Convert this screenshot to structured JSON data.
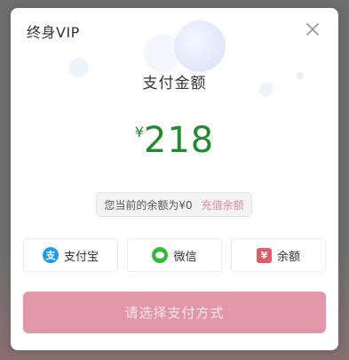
{
  "dialog": {
    "title": "终身VIP",
    "close_icon": "close-icon"
  },
  "payment": {
    "amount_label": "支付金额",
    "currency_symbol": "¥",
    "amount": "218",
    "balance_text": "您当前的余额为¥0",
    "recharge_link": "充值余额"
  },
  "methods": [
    {
      "label": "支付宝",
      "icon": "alipay-icon",
      "icon_glyph": "支",
      "color": "#1d9bf0"
    },
    {
      "label": "微信",
      "icon": "wechat-icon",
      "icon_glyph": "●",
      "color": "#2fbc3a"
    },
    {
      "label": "余额",
      "icon": "balance-icon",
      "icon_glyph": "¥",
      "color": "#e45b67"
    }
  ],
  "submit_label": "请选择支付方式",
  "colors": {
    "price": "#1f8a2e",
    "accent": "#e297a9",
    "recharge_link": "#e0899a"
  }
}
